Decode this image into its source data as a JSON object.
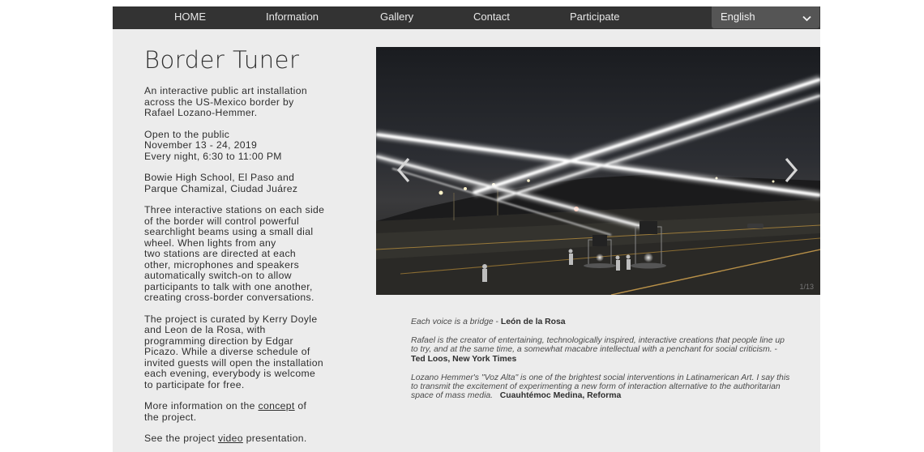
{
  "nav": {
    "items": [
      {
        "label": "HOME"
      },
      {
        "label": "Information"
      },
      {
        "label": "Gallery"
      },
      {
        "label": "Contact"
      },
      {
        "label": "Participate"
      }
    ],
    "language": {
      "selected": "English",
      "icon": "chevron-down-icon"
    }
  },
  "left": {
    "title": "Border Tuner",
    "intro": "An interactive public art installation\nacross the US-Mexico border by\nRafael Lozano-Hemmer.",
    "schedule": "Open to the public\nNovember 13 - 24, 2019\nEvery night, 6:30 to 11:00 PM",
    "venues": "Bowie High School, El Paso and\nParque Chamizal, Ciudad Juárez",
    "description": "Three interactive stations on each side\nof the border will control powerful\nsearchlight beams using a small dial\nwheel. When lights from any\ntwo stations are directed at each\nother, microphones and speakers\nautomatically switch-on to allow\nparticipants to talk with one another,\ncreating cross-border conversations.",
    "curation": "The project is curated by Kerry Doyle\nand Leon de la Rosa, with\nprogramming direction by Edgar\nPicazo. While a diverse schedule of\ninvited guests will open the installation\neach evening, everybody is welcome\nto participate for free.",
    "more_info": {
      "before": "More information on the ",
      "link": "concept",
      "after": " of\nthe project."
    },
    "video": {
      "before": "See the project ",
      "link": "video",
      "after": " presentation."
    }
  },
  "slider": {
    "counter": "1/13",
    "prev_icon": "chevron-left-icon",
    "next_icon": "chevron-right-icon"
  },
  "quotes": [
    {
      "text": "Each voice is a bridge",
      "sep": " - ",
      "author": "León de la Rosa"
    },
    {
      "text": "Rafael is the creator of entertaining, technologically inspired, interactive creations that people line up to try, and at the same time, a somewhat macabre intellectual with a penchant for social criticism.",
      "sep": " - ",
      "author": "Ted Loos, New York Times"
    },
    {
      "text": "Lozano Hemmer's \"Voz Alta\" is one of the brightest social interventions in Latinamerican Art. I say this to transmit the excitement of experimenting a new form of interaction alternative to the authoritarian space of mass media.",
      "sep": "   ",
      "author": "Cuauhtémoc Medina, Reforma"
    }
  ]
}
